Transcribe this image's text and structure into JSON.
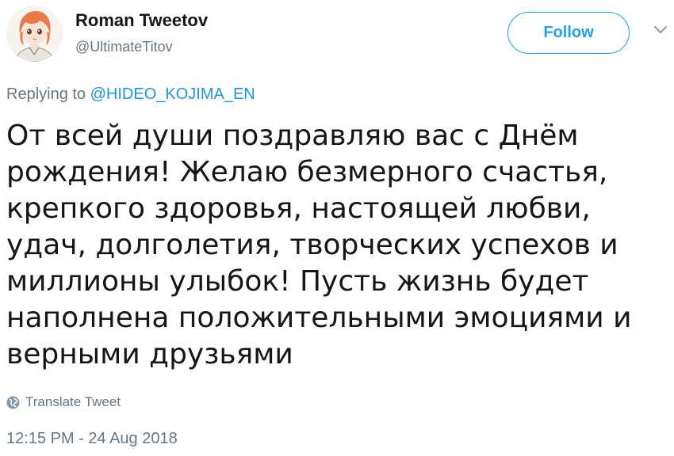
{
  "user": {
    "display_name": "Roman Tweetov",
    "handle": "@UltimateTitov",
    "avatar_icon": "anime-avatar-icon"
  },
  "follow_button": {
    "label": "Follow"
  },
  "menu": {
    "icon": "chevron-down-icon"
  },
  "reply": {
    "prefix": "Replying to",
    "mention": "@HIDEO_KOJIMA_EN"
  },
  "tweet": {
    "lines": [
      "От всей души поздравляю вас с Днём",
      "рождения! Желаю безмерного счастья,",
      "крепкого здоровья, настоящей любви,",
      "удач, долголетия, творческих успехов и",
      "миллионы улыбок! Пусть жизнь будет",
      "наполнена положительными эмоциями и",
      "верными друзьями"
    ]
  },
  "translate": {
    "label": "Translate Tweet",
    "icon": "globe-icon"
  },
  "timestamp": "12:15 PM - 24 Aug 2018",
  "colors": {
    "accent": "#1da1f2",
    "mention": "#1b95e0",
    "secondary_text": "#657786",
    "primary_text": "#14171a"
  }
}
